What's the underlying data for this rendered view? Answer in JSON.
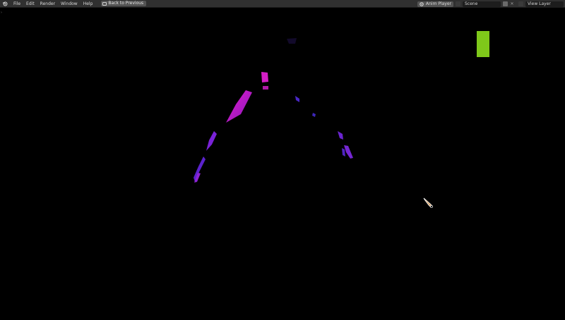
{
  "menu": {
    "items": [
      "File",
      "Edit",
      "Render",
      "Window",
      "Help"
    ],
    "back_button_label": "Back to Previous"
  },
  "header_right": {
    "editor_label": "Anim Player",
    "scene_field": "Scene",
    "view_layer_field": "View Layer"
  },
  "viewport": {
    "background": "#000000",
    "accent_colors": {
      "magenta": "#d81ec8",
      "violet": "#6a22d0",
      "green_bar": "#7fc81a"
    },
    "cursor_icon": "eyedropper-cursor-icon"
  }
}
